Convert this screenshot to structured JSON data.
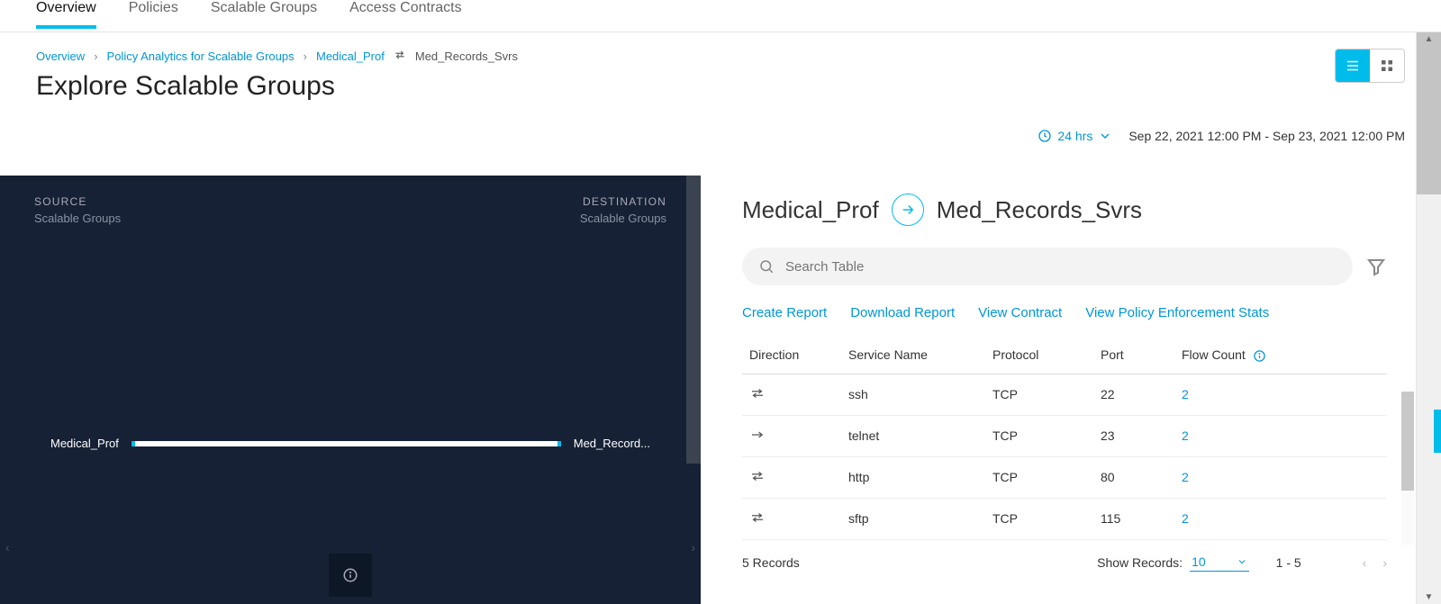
{
  "tabs": {
    "t0": "Overview",
    "t1": "Policies",
    "t2": "Scalable Groups",
    "t3": "Access Contracts"
  },
  "breadcrumb": {
    "b0": "Overview",
    "b1": "Policy Analytics for Scalable Groups",
    "b2": "Medical_Prof",
    "b3": "Med_Records_Svrs"
  },
  "page_title": "Explore Scalable Groups",
  "time": {
    "selector_label": "24 hrs",
    "range": "Sep 22, 2021 12:00 PM - Sep 23, 2021 12:00 PM"
  },
  "viz": {
    "source_lbl": "SOURCE",
    "dest_lbl": "DESTINATION",
    "sub_lbl": "Scalable Groups",
    "node_left": "Medical_Prof",
    "node_right": "Med_Record..."
  },
  "detail": {
    "from": "Medical_Prof",
    "to": "Med_Records_Svrs",
    "search_placeholder": "Search Table",
    "actions": {
      "a0": "Create Report",
      "a1": "Download Report",
      "a2": "View Contract",
      "a3": "View Policy Enforcement Stats"
    },
    "columns": {
      "c0": "Direction",
      "c1": "Service Name",
      "c2": "Protocol",
      "c3": "Port",
      "c4": "Flow Count"
    },
    "rows": [
      {
        "dir": "bi",
        "service": "ssh",
        "protocol": "TCP",
        "port": "22",
        "flow": "2"
      },
      {
        "dir": "uni",
        "service": "telnet",
        "protocol": "TCP",
        "port": "23",
        "flow": "2"
      },
      {
        "dir": "bi",
        "service": "http",
        "protocol": "TCP",
        "port": "80",
        "flow": "2"
      },
      {
        "dir": "bi",
        "service": "sftp",
        "protocol": "TCP",
        "port": "115",
        "flow": "2"
      }
    ],
    "records_text": "5 Records",
    "show_records_label": "Show Records:",
    "show_records_value": "10",
    "pager_text": "1 - 5"
  }
}
